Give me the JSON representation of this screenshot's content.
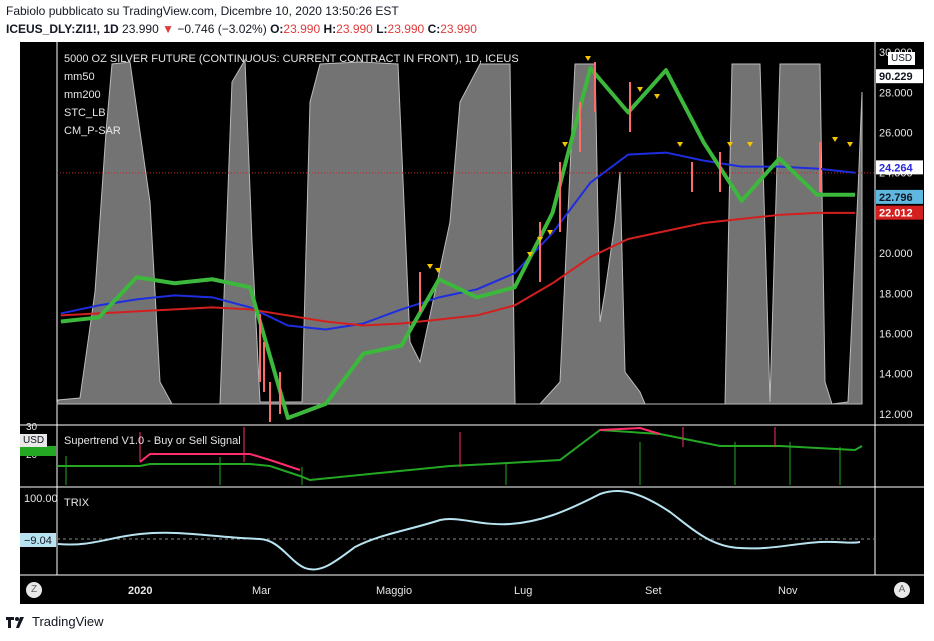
{
  "header": {
    "line1": "Fabiolo pubblicato su TradingView.com, Dicembre 10, 2020 13:50:26 EST",
    "symbol": "ICEUS_DLY:ZI1!, 1D",
    "last": "23.990",
    "change": "−0.746 (−3.02%)",
    "open_label": "O:",
    "open": "23.990",
    "high_label": "H:",
    "high": "23.990",
    "low_label": "L:",
    "low": "23.990",
    "close_label": "C:",
    "close": "23.990"
  },
  "main_pane": {
    "title": "5000 OZ SILVER FUTURE (CONTINUOUS: CURRENT CONTRACT IN FRONT), 1D, ICEUS",
    "indicators": [
      "mm50",
      "mm200",
      "STC_LB",
      "CM_P-SAR"
    ],
    "currency": "USD",
    "price_ticks": [
      "30.000",
      "28.000",
      "26.000",
      "24.000",
      "22.000",
      "20.000",
      "18.000",
      "16.000",
      "14.000",
      "12.000"
    ],
    "tags": [
      {
        "text": "90.229",
        "color": "#ffffff",
        "bg": "#ffffff",
        "fg": "#131722",
        "price": 28.8
      },
      {
        "text": "24.264",
        "bg": "#ffffff",
        "fg": "#2929d9",
        "price": 24.264
      },
      {
        "text": "22.796",
        "bg": "#5fb8e0",
        "fg": "#131722",
        "price": 22.796
      },
      {
        "text": "22.012",
        "bg": "#d41f1f",
        "fg": "#ffffff",
        "price": 22.012
      }
    ]
  },
  "supertrend_pane": {
    "title": "Supertrend V1.0 - Buy or Sell Signal",
    "currency": "USD",
    "ticks": [
      "30",
      "20"
    ]
  },
  "trix_pane": {
    "title": "TRIX",
    "ticks": [
      "100.00"
    ],
    "value_tag": "−9.04"
  },
  "time_axis": [
    "2020",
    "Mar",
    "Maggio",
    "Lug",
    "Set",
    "Nov"
  ],
  "buttons": {
    "left": "Z",
    "right": "A"
  },
  "footer": {
    "brand": "TradingView"
  },
  "colors": {
    "mm50": "#1e2de0",
    "mm200": "#d41f1f",
    "stc_fill": "#9a9a9a",
    "sar_up": "#3cb83c",
    "sar_down": "#c40e0e",
    "trix": "#b8e3f0"
  },
  "chart_data": {
    "type": "line",
    "title": "5000 OZ SILVER FUTURE (CONTINUOUS: CURRENT CONTRACT IN FRONT), 1D, ICEUS",
    "x_labels": [
      "2020",
      "Mar",
      "Maggio",
      "Lug",
      "Set",
      "Nov"
    ],
    "ylim": [
      11.5,
      30.5
    ],
    "series": [
      {
        "name": "mm50",
        "values": [
          17.0,
          17.4,
          17.7,
          17.9,
          17.8,
          17.3,
          16.4,
          16.2,
          16.5,
          17.2,
          17.8,
          18.2,
          19.0,
          21.0,
          23.5,
          24.9,
          25.0,
          24.6,
          24.3,
          24.3,
          24.2,
          24.0
        ]
      },
      {
        "name": "mm200",
        "values": [
          16.9,
          17.0,
          17.1,
          17.2,
          17.3,
          17.2,
          16.9,
          16.6,
          16.4,
          16.5,
          16.7,
          16.9,
          17.4,
          18.5,
          19.8,
          20.7,
          21.1,
          21.5,
          21.7,
          21.9,
          22.0,
          22.0
        ]
      },
      {
        "name": "SAR",
        "values": [
          16.6,
          16.8,
          18.8,
          18.5,
          18.7,
          18.3,
          11.8,
          12.5,
          15.0,
          15.4,
          18.7,
          17.8,
          18.3,
          22.0,
          29.2,
          27.0,
          29.1,
          25.5,
          22.6,
          24.7,
          22.9,
          22.9
        ]
      }
    ]
  }
}
